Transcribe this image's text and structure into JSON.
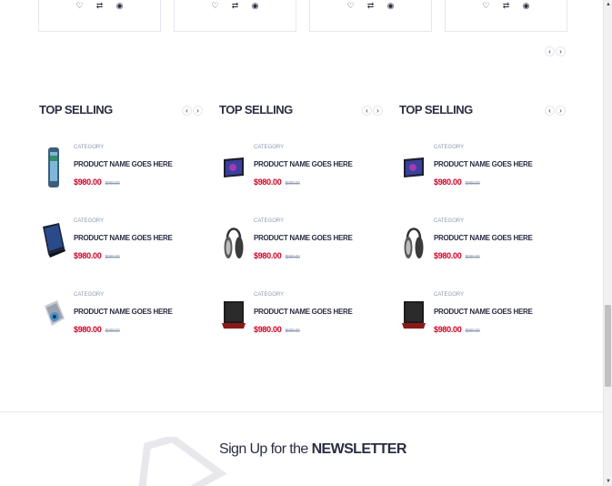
{
  "top_cards": [
    {
      "actions": [
        "♡",
        "⇄",
        "◉"
      ]
    },
    {
      "actions": [
        "♡",
        "⇄",
        "◉"
      ]
    },
    {
      "actions": [
        "♡",
        "⇄",
        "◉"
      ]
    },
    {
      "actions": [
        "♡",
        "⇄",
        "◉"
      ]
    }
  ],
  "nav": {
    "prev": "‹",
    "next": "›"
  },
  "widgets": [
    {
      "title": "TOP SELLING",
      "products": [
        {
          "category": "CATEGORY",
          "name": "PRODUCT NAME GOES HERE",
          "price": "$980.00",
          "old_price": "$990.00",
          "image": "phone"
        },
        {
          "category": "CATEGORY",
          "name": "PRODUCT NAME GOES HERE",
          "price": "$980.00",
          "old_price": "$990.00",
          "image": "laptop"
        },
        {
          "category": "CATEGORY",
          "name": "PRODUCT NAME GOES HERE",
          "price": "$980.00",
          "old_price": "$990.00",
          "image": "camera"
        }
      ]
    },
    {
      "title": "TOP SELLING",
      "products": [
        {
          "category": "CATEGORY",
          "name": "PRODUCT NAME GOES HERE",
          "price": "$980.00",
          "old_price": "$990.00",
          "image": "tablet"
        },
        {
          "category": "CATEGORY",
          "name": "PRODUCT NAME GOES HERE",
          "price": "$980.00",
          "old_price": "$990.00",
          "image": "headphones"
        },
        {
          "category": "CATEGORY",
          "name": "PRODUCT NAME GOES HERE",
          "price": "$980.00",
          "old_price": "$990.00",
          "image": "laptop-open"
        }
      ]
    },
    {
      "title": "TOP SELLING",
      "products": [
        {
          "category": "CATEGORY",
          "name": "PRODUCT NAME GOES HERE",
          "price": "$980.00",
          "old_price": "$990.00",
          "image": "tablet"
        },
        {
          "category": "CATEGORY",
          "name": "PRODUCT NAME GOES HERE",
          "price": "$980.00",
          "old_price": "$990.00",
          "image": "headphones"
        },
        {
          "category": "CATEGORY",
          "name": "PRODUCT NAME GOES HERE",
          "price": "$980.00",
          "old_price": "$990.00",
          "image": "laptop-open"
        }
      ]
    }
  ],
  "newsletter": {
    "prefix": "Sign Up for the ",
    "emphasis": "NEWSLETTER"
  },
  "colors": {
    "price": "#d10024",
    "heading": "#2b2d42",
    "muted": "#8d99ae",
    "border": "#e4e7ed"
  }
}
